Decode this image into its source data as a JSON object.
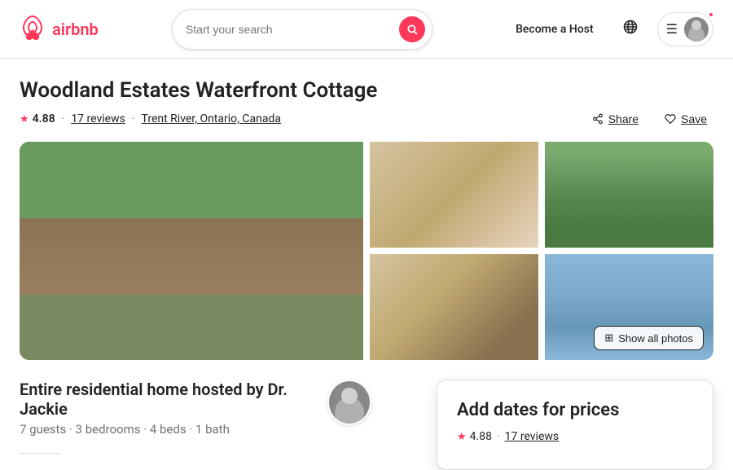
{
  "header": {
    "logo_text": "airbnb",
    "search_placeholder": "Start your search",
    "become_host": "Become a Host",
    "menu_label": "Menu"
  },
  "listing": {
    "title": "Woodland Estates Waterfront Cottage",
    "rating": "4.88",
    "reviews_count": "17 reviews",
    "location": "Trent River, Ontario, Canada",
    "share_label": "Share",
    "save_label": "Save",
    "hosting_title": "Entire residential home hosted by Dr. Jackie",
    "hosting_details": "7 guests · 3 bedrooms · 4 beds · 1 bath"
  },
  "booking_card": {
    "title": "Add dates for prices",
    "rating": "4.88",
    "reviews": "17 reviews"
  },
  "photos": {
    "show_all_label": "Show all photos",
    "grid_icon": "⊞"
  }
}
